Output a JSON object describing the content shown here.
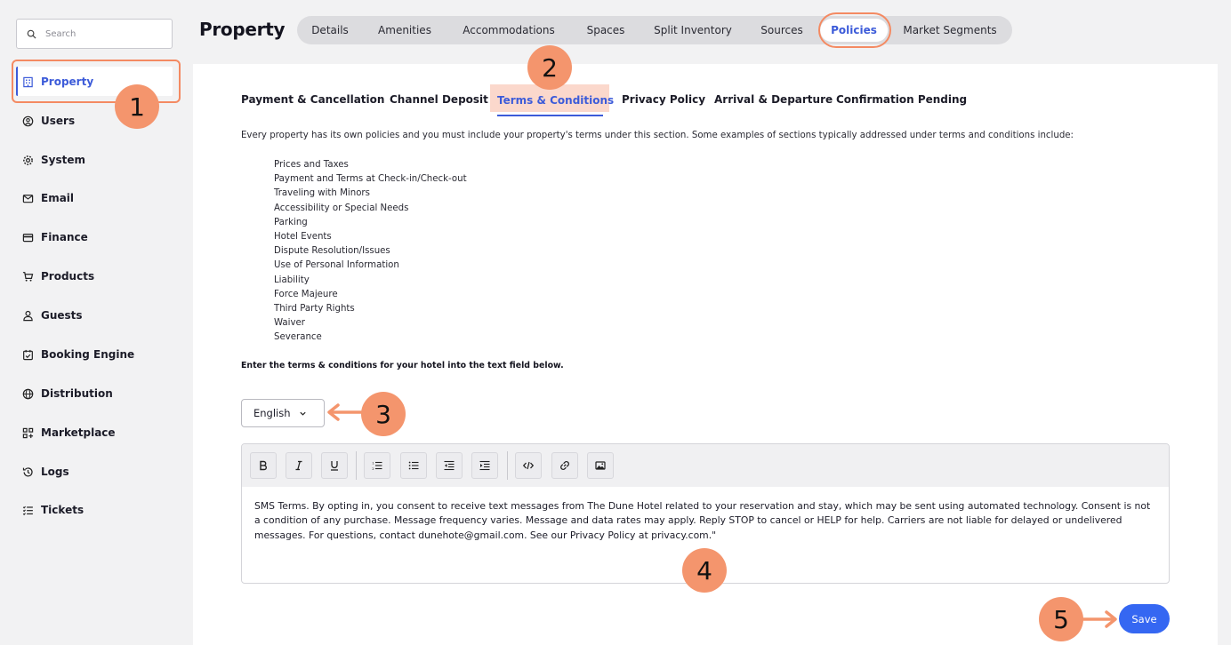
{
  "sidebar": {
    "search_placeholder": "Search",
    "items": [
      {
        "label": "Property",
        "icon": "building-icon",
        "active": true
      },
      {
        "label": "Users",
        "icon": "user-circle-icon"
      },
      {
        "label": "System",
        "icon": "gear-icon"
      },
      {
        "label": "Email",
        "icon": "mail-icon"
      },
      {
        "label": "Finance",
        "icon": "credit-card-icon"
      },
      {
        "label": "Products",
        "icon": "cart-icon"
      },
      {
        "label": "Guests",
        "icon": "person-icon"
      },
      {
        "label": "Booking Engine",
        "icon": "calendar-check-icon"
      },
      {
        "label": "Distribution",
        "icon": "globe-icon"
      },
      {
        "label": "Marketplace",
        "icon": "apps-plus-icon"
      },
      {
        "label": "Logs",
        "icon": "history-icon"
      },
      {
        "label": "Tickets",
        "icon": "list-check-icon"
      }
    ]
  },
  "header": {
    "title": "Property",
    "tabs": [
      "Details",
      "Amenities",
      "Accommodations",
      "Spaces",
      "Split Inventory",
      "Sources",
      "Policies",
      "Market Segments"
    ],
    "active_tab": "Policies"
  },
  "subtabs": {
    "items": [
      "Payment & Cancellation",
      "Channel Deposit",
      "Terms & Conditions",
      "Privacy Policy",
      "Arrival & Departure",
      "Confirmation Pending"
    ],
    "active": "Terms & Conditions"
  },
  "content": {
    "intro": "Every property has its own policies and you must include your property's terms under this section. Some examples of sections typically addressed under terms and conditions include:",
    "list": [
      "Prices and Taxes",
      "Payment and Terms at Check-in/Check-out",
      "Traveling with Minors",
      "Accessibility or Special Needs",
      "Parking",
      "Hotel Events",
      "Dispute Resolution/Issues",
      "Use of Personal Information",
      "Liability",
      "Force Majeure",
      "Third Party Rights",
      "Waiver",
      "Severance"
    ],
    "instruction": "Enter the terms & conditions for your hotel into the text field below."
  },
  "language": {
    "selected": "English"
  },
  "editor": {
    "toolbar": [
      "bold-icon",
      "italic-icon",
      "underline-icon",
      "ordered-list-icon",
      "bullet-list-icon",
      "outdent-icon",
      "indent-icon",
      "code-icon",
      "link-icon",
      "image-icon"
    ],
    "text": " SMS Terms. By opting in, you consent to receive text messages from The Dune Hotel related to your reservation and stay, which may be sent using automated technology. Consent is not a condition of any purchase. Message frequency varies. Message and data rates may apply. Reply STOP to cancel or HELP for help. Carriers are not liable for delayed or undelivered messages. For questions, contact dunehote@gmail.com. See our Privacy Policy at privacy.com.\""
  },
  "save_label": "Save",
  "annotations": [
    "1",
    "2",
    "3",
    "4",
    "5"
  ],
  "colors": {
    "accent": "#3c5bd9",
    "annotation": "#f4956d",
    "save": "#3567f2"
  }
}
